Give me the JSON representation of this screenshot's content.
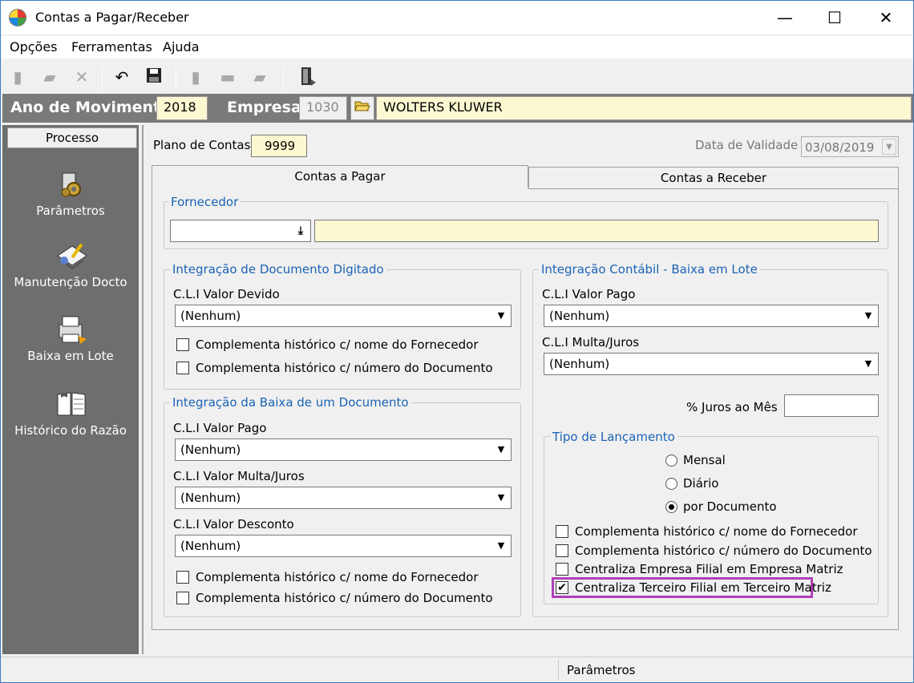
{
  "window": {
    "title": "Contas a Pagar/Receber",
    "minimize": "—",
    "maximize": "☐",
    "close": "✕"
  },
  "menu": [
    {
      "label": "Opções"
    },
    {
      "label": "Ferramentas"
    },
    {
      "label": "Ajuda"
    }
  ],
  "header": {
    "ano_label": "Ano de Movimento",
    "ano_value": "2018",
    "empresa_label": "Empresa",
    "empresa_code": "1030",
    "empresa_name": "WOLTERS KLUWER"
  },
  "sidebar": {
    "button": "Processo",
    "items": [
      {
        "label": "Parâmetros",
        "icon": "gears-icon"
      },
      {
        "label": "Manutenção Docto",
        "icon": "document-edit-icon"
      },
      {
        "label": "Baixa em Lote",
        "icon": "printer-icon"
      },
      {
        "label": "Histórico do Razão",
        "icon": "book-icon"
      }
    ]
  },
  "form": {
    "plano_label": "Plano de Contas",
    "plano_value": "9999",
    "validade_label": "Data de Validade",
    "validade_value": "03/08/2019"
  },
  "tabs": [
    {
      "label": "Contas a Pagar",
      "active": true
    },
    {
      "label": "Contas a Receber",
      "active": false
    }
  ],
  "fornecedor": {
    "title": "Fornecedor",
    "code": "",
    "name": ""
  },
  "integracao_documento": {
    "title": "Integração de Documento Digitado",
    "cli_valor_devido_label": "C.L.I Valor Devido",
    "cli_valor_devido_value": "(Nenhum)",
    "check1": "Complementa histórico c/ nome do Fornecedor",
    "check2": "Complementa histórico c/ número do Documento"
  },
  "integracao_baixa": {
    "title": "Integração da Baixa de um Documento",
    "valor_pago_label": "C.L.I Valor Pago",
    "valor_pago_value": "(Nenhum)",
    "multa_label": "C.L.I Valor Multa/Juros",
    "multa_value": "(Nenhum)",
    "desconto_label": "C.L.I Valor Desconto",
    "desconto_value": "(Nenhum)",
    "check1": "Complementa histórico c/ nome do Fornecedor",
    "check2": "Complementa histórico c/ número do Documento"
  },
  "integracao_contabil": {
    "title": "Integração Contábil - Baixa em Lote",
    "valor_pago_label": "C.L.I Valor Pago",
    "valor_pago_value": "(Nenhum)",
    "multa_label": "C.L.I Multa/Juros",
    "multa_value": "(Nenhum)",
    "juros_label": "% Juros ao Mês",
    "juros_value": ""
  },
  "tipo_lancamento": {
    "title": "Tipo de Lançamento",
    "options": [
      {
        "label": "Mensal",
        "selected": false
      },
      {
        "label": "Diário",
        "selected": false
      },
      {
        "label": "por Documento",
        "selected": true
      }
    ],
    "checks": [
      {
        "label": "Complementa histórico c/ nome do Fornecedor",
        "checked": false
      },
      {
        "label": "Complementa histórico c/ número do Documento",
        "checked": false
      },
      {
        "label": "Centraliza Empresa Filial em Empresa Matriz",
        "checked": false
      },
      {
        "label": "Centraliza Terceiro Filial em Terceiro Matriz",
        "checked": true
      }
    ],
    "check_mark": "✔"
  },
  "status": {
    "left": "",
    "right": "Parâmetros"
  },
  "colors": {
    "highlight_border": "#b040b8",
    "group_title": "#1a63b5",
    "field_yellow": "#fcf8d2",
    "sidebar_gray": "#6e6e6e"
  }
}
